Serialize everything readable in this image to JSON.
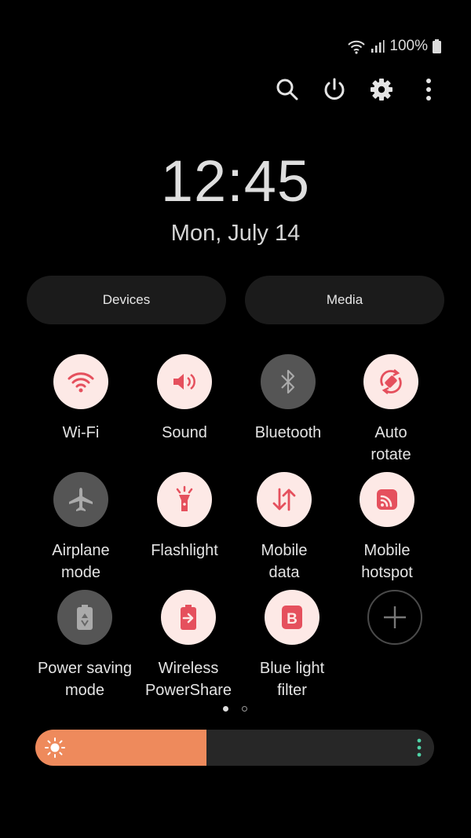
{
  "status": {
    "battery": "100%",
    "icons": [
      "wifi-icon",
      "signal-icon",
      "battery-icon"
    ]
  },
  "top_icons": [
    "search-icon",
    "power-icon",
    "gear-icon",
    "more-vert-icon"
  ],
  "clock": {
    "time": "12:45",
    "date": "Mon, July 14"
  },
  "buttons": {
    "devices": "Devices",
    "media": "Media"
  },
  "tiles": [
    {
      "line1": "Wi-Fi",
      "line2": "",
      "icon": "wifi-icon",
      "state": "on"
    },
    {
      "line1": "Sound",
      "line2": "",
      "icon": "sound-icon",
      "state": "on"
    },
    {
      "line1": "Bluetooth",
      "line2": "",
      "icon": "bluetooth-icon",
      "state": "off"
    },
    {
      "line1": "Auto",
      "line2": "rotate",
      "icon": "auto-rotate-icon",
      "state": "on"
    },
    {
      "line1": "Airplane",
      "line2": "mode",
      "icon": "airplane-icon",
      "state": "off"
    },
    {
      "line1": "Flashlight",
      "line2": "",
      "icon": "flashlight-icon",
      "state": "on"
    },
    {
      "line1": "Mobile",
      "line2": "data",
      "icon": "mobile-data-icon",
      "state": "on"
    },
    {
      "line1": "Mobile",
      "line2": "hotspot",
      "icon": "hotspot-icon",
      "state": "on"
    },
    {
      "line1": "Power saving",
      "line2": "mode",
      "icon": "power-saving-icon",
      "state": "off"
    },
    {
      "line1": "Wireless",
      "line2": "PowerShare",
      "icon": "wireless-powershare-icon",
      "state": "on"
    },
    {
      "line1": "Blue light",
      "line2": "filter",
      "icon": "blue-light-filter-icon",
      "state": "on"
    }
  ],
  "add_tile_icon": "plus-icon",
  "pager": {
    "pages": 2,
    "current": 1
  },
  "brightness": {
    "level": 0.43,
    "icon": "sun-icon"
  },
  "colors": {
    "accent": "#e5505d",
    "tile_on_bg": "#fde9e6",
    "tile_off_bg": "#555555",
    "brightness_fill": "#ee8a5c",
    "background": "#000000"
  }
}
